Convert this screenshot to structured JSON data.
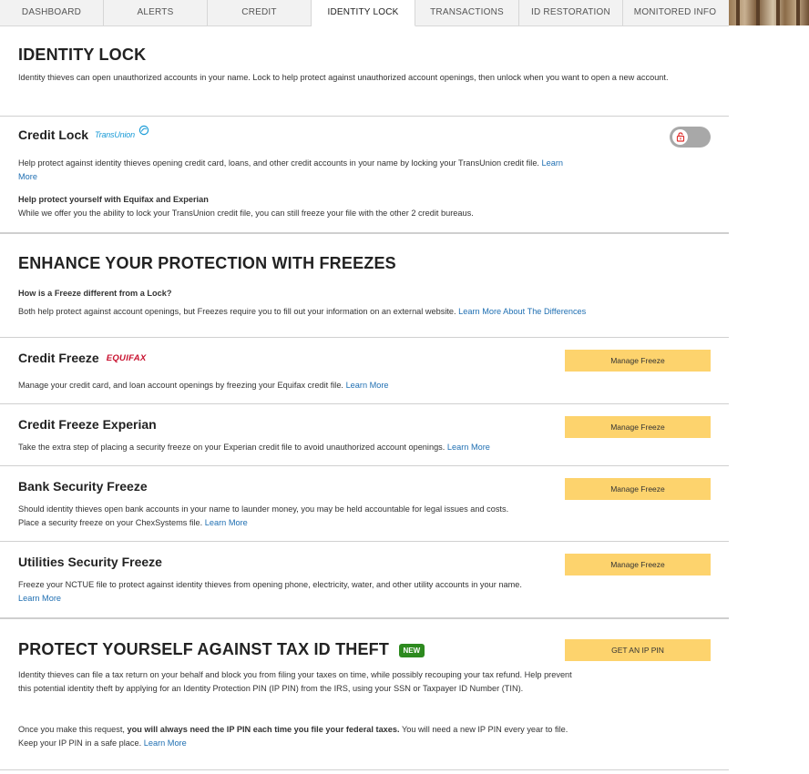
{
  "tabs": [
    {
      "label": "DASHBOARD"
    },
    {
      "label": "ALERTS"
    },
    {
      "label": "CREDIT"
    },
    {
      "label": "IDENTITY LOCK"
    },
    {
      "label": "TRANSACTIONS"
    },
    {
      "label": "ID RESTORATION"
    },
    {
      "label": "MONITORED INFO"
    }
  ],
  "active_tab": "IDENTITY LOCK",
  "identity_lock": {
    "title": "IDENTITY LOCK",
    "description": "Identity thieves can open unauthorized accounts in your name. Lock to help protect against unauthorized account openings, then unlock when you want to open a new account."
  },
  "credit_lock": {
    "title": "Credit Lock",
    "logo_text": "TransUnion",
    "description": "Help protect against identity thieves opening credit card, loans, and other credit accounts in your name by locking your TransUnion credit file.",
    "learn_more": "Learn More",
    "toggle_state": "locked",
    "subhead": "Help protect yourself with Equifax and Experian",
    "subtext": "While we offer you the ability to lock your TransUnion credit file, you can still freeze your file with the other 2 credit bureaus."
  },
  "freezes": {
    "title": "ENHANCE YOUR PROTECTION WITH FREEZES",
    "question": "How is a Freeze different from a Lock?",
    "answer": "Both help protect against account openings, but Freezes require you to fill out your information on an external website.",
    "answer_link": "Learn More About The Differences",
    "items": [
      {
        "title": "Credit Freeze",
        "logo_text": "EQUIFAX",
        "description": "Manage your credit card, and loan account openings by freezing your Equifax credit file.",
        "learn_more": "Learn More",
        "button": "Manage Freeze"
      },
      {
        "title": "Credit Freeze Experian",
        "description": "Take the extra step of placing a security freeze on your Experian credit file to avoid unauthorized account openings.",
        "learn_more": "Learn More",
        "button": "Manage Freeze"
      },
      {
        "title": "Bank Security Freeze",
        "description_line1": "Should identity thieves open bank accounts in your name to launder money, you may be held accountable for legal issues and costs.",
        "description_line2": "Place a security freeze on your ChexSystems file.",
        "learn_more": "Learn More",
        "button": "Manage Freeze"
      },
      {
        "title": "Utilities Security Freeze",
        "description": "Freeze your NCTUE file to protect against identity thieves from opening phone, electricity, water, and other utility accounts in your name.",
        "learn_more": "Learn More",
        "button": "Manage Freeze"
      }
    ]
  },
  "tax": {
    "title": "PROTECT YOURSELF AGAINST TAX ID THEFT",
    "badge": "NEW",
    "button": "GET AN IP PIN",
    "para1": "Identity thieves can file a tax return on your behalf and block you from filing your taxes on time, while possibly recouping your tax refund. Help prevent this potential identity theft by applying for an Identity Protection PIN (IP PIN) from the IRS, using your SSN or Taxpayer ID Number (TIN).",
    "para2_pre": "Once you make this request,",
    "para2_bold": "you will always need the IP PIN each time you file your federal taxes.",
    "para2_post": "You will need a new IP PIN every year to file. Keep your IP PIN in a safe place.",
    "learn_more": "Learn More"
  },
  "colors": {
    "button_bg": "#fdd36d",
    "link": "#1f6fb2",
    "new_badge": "#2d8a1f",
    "equifax_red": "#c8102e",
    "transunion_blue": "#1a9bd7",
    "toggle_bg": "#a8a8a8",
    "lock_icon": "#e0312f"
  }
}
